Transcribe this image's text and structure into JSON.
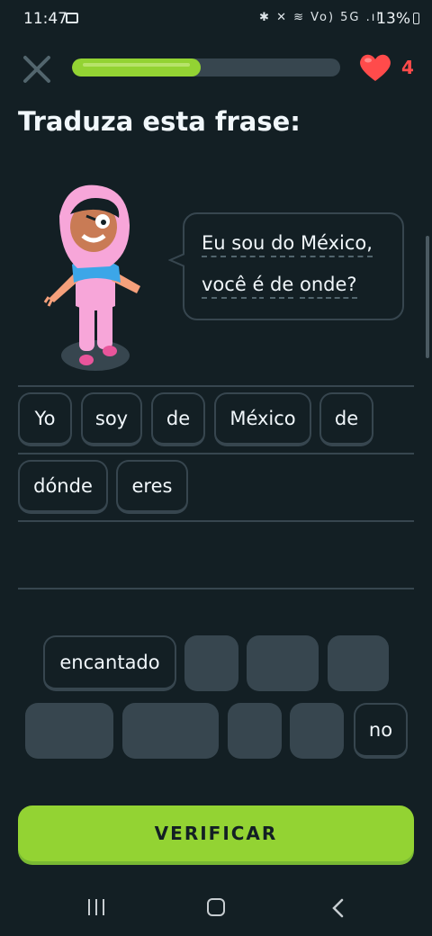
{
  "status_bar": {
    "time": "11:47",
    "icons": "✱ ✕ ≋ Vo) 5G .ıl",
    "battery": "13%"
  },
  "header": {
    "progress_fraction": 0.48,
    "hearts": "4",
    "colors": {
      "progress": "#93d333",
      "heart": "#ff4b4b"
    }
  },
  "title": "Traduza esta frase:",
  "prompt": {
    "line1": [
      "Eu",
      "sou",
      "do",
      "México,"
    ],
    "line2": [
      "você",
      "é",
      "de",
      "onde?"
    ]
  },
  "answer_chips": [
    "Yo",
    "soy",
    "de",
    "México",
    "de",
    "dónde",
    "eres"
  ],
  "bank_chips": {
    "encantado": "encantado",
    "no": "no"
  },
  "verify_label": "VERIFICAR"
}
